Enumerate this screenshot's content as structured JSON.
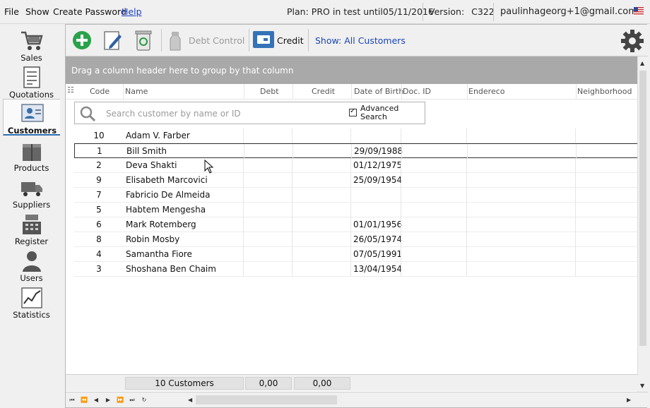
{
  "menu": {
    "file": "File",
    "show": "Show",
    "change_password": "Create Password",
    "help": "Help"
  },
  "plan": {
    "prefix": "Plan:",
    "plan_name": "PRO",
    "middle": "in test until",
    "date": "05/11/2016"
  },
  "version": {
    "label": "Version:",
    "value": "C322"
  },
  "user_email": "paulinhageorg+1@gmail.com",
  "sidebar": {
    "items": [
      {
        "label": "Sales",
        "icon": "cart-icon"
      },
      {
        "label": "Quotations",
        "icon": "document-icon"
      },
      {
        "label": "Customers",
        "icon": "customers-icon",
        "active": true
      },
      {
        "label": "Products",
        "icon": "boxes-icon"
      },
      {
        "label": "Suppliers",
        "icon": "truck-icon"
      },
      {
        "label": "Register",
        "icon": "cash-register-icon"
      },
      {
        "label": "Users",
        "icon": "user-icon"
      },
      {
        "label": "Statistics",
        "icon": "chart-icon"
      }
    ]
  },
  "toolbar": {
    "debt_control": "Debt Control",
    "credit": "Credit",
    "show_filter": "Show: All Customers"
  },
  "group_hint": "Drag a column header here to group by that column",
  "columns": [
    "Code",
    "Name",
    "Debt",
    "Credit",
    "Date of Birth",
    "Doc. ID",
    "Endereco",
    "Neighborhood"
  ],
  "search": {
    "placeholder": "Search customer by name or ID",
    "advanced_line1": "Advanced",
    "advanced_line2": "Search"
  },
  "rows": [
    {
      "code": "10",
      "name": "Adam V. Farber",
      "dob": ""
    },
    {
      "code": "1",
      "name": "Bill Smith",
      "dob": "29/09/1988"
    },
    {
      "code": "2",
      "name": "Deva Shakti",
      "dob": "01/12/1975"
    },
    {
      "code": "9",
      "name": "Elisabeth Marcovici",
      "dob": "25/09/1954"
    },
    {
      "code": "7",
      "name": "Fabricio De Almeida",
      "dob": ""
    },
    {
      "code": "5",
      "name": "Habtem Mengesha",
      "dob": ""
    },
    {
      "code": "6",
      "name": "Mark Rotemberg",
      "dob": "01/01/1956"
    },
    {
      "code": "8",
      "name": "Robin Mosby",
      "dob": "26/05/1974"
    },
    {
      "code": "4",
      "name": "Samantha Fiore",
      "dob": "07/05/1991"
    },
    {
      "code": "3",
      "name": "Shoshana Ben Chaim",
      "dob": "13/04/1954"
    }
  ],
  "footer": {
    "count": "10 Customers",
    "debt_total": "0,00",
    "credit_total": "0,00"
  },
  "colors": {
    "accent": "#2f6fb3",
    "credit_button": "#3472b8",
    "group_bar": "#a9a9a9"
  }
}
